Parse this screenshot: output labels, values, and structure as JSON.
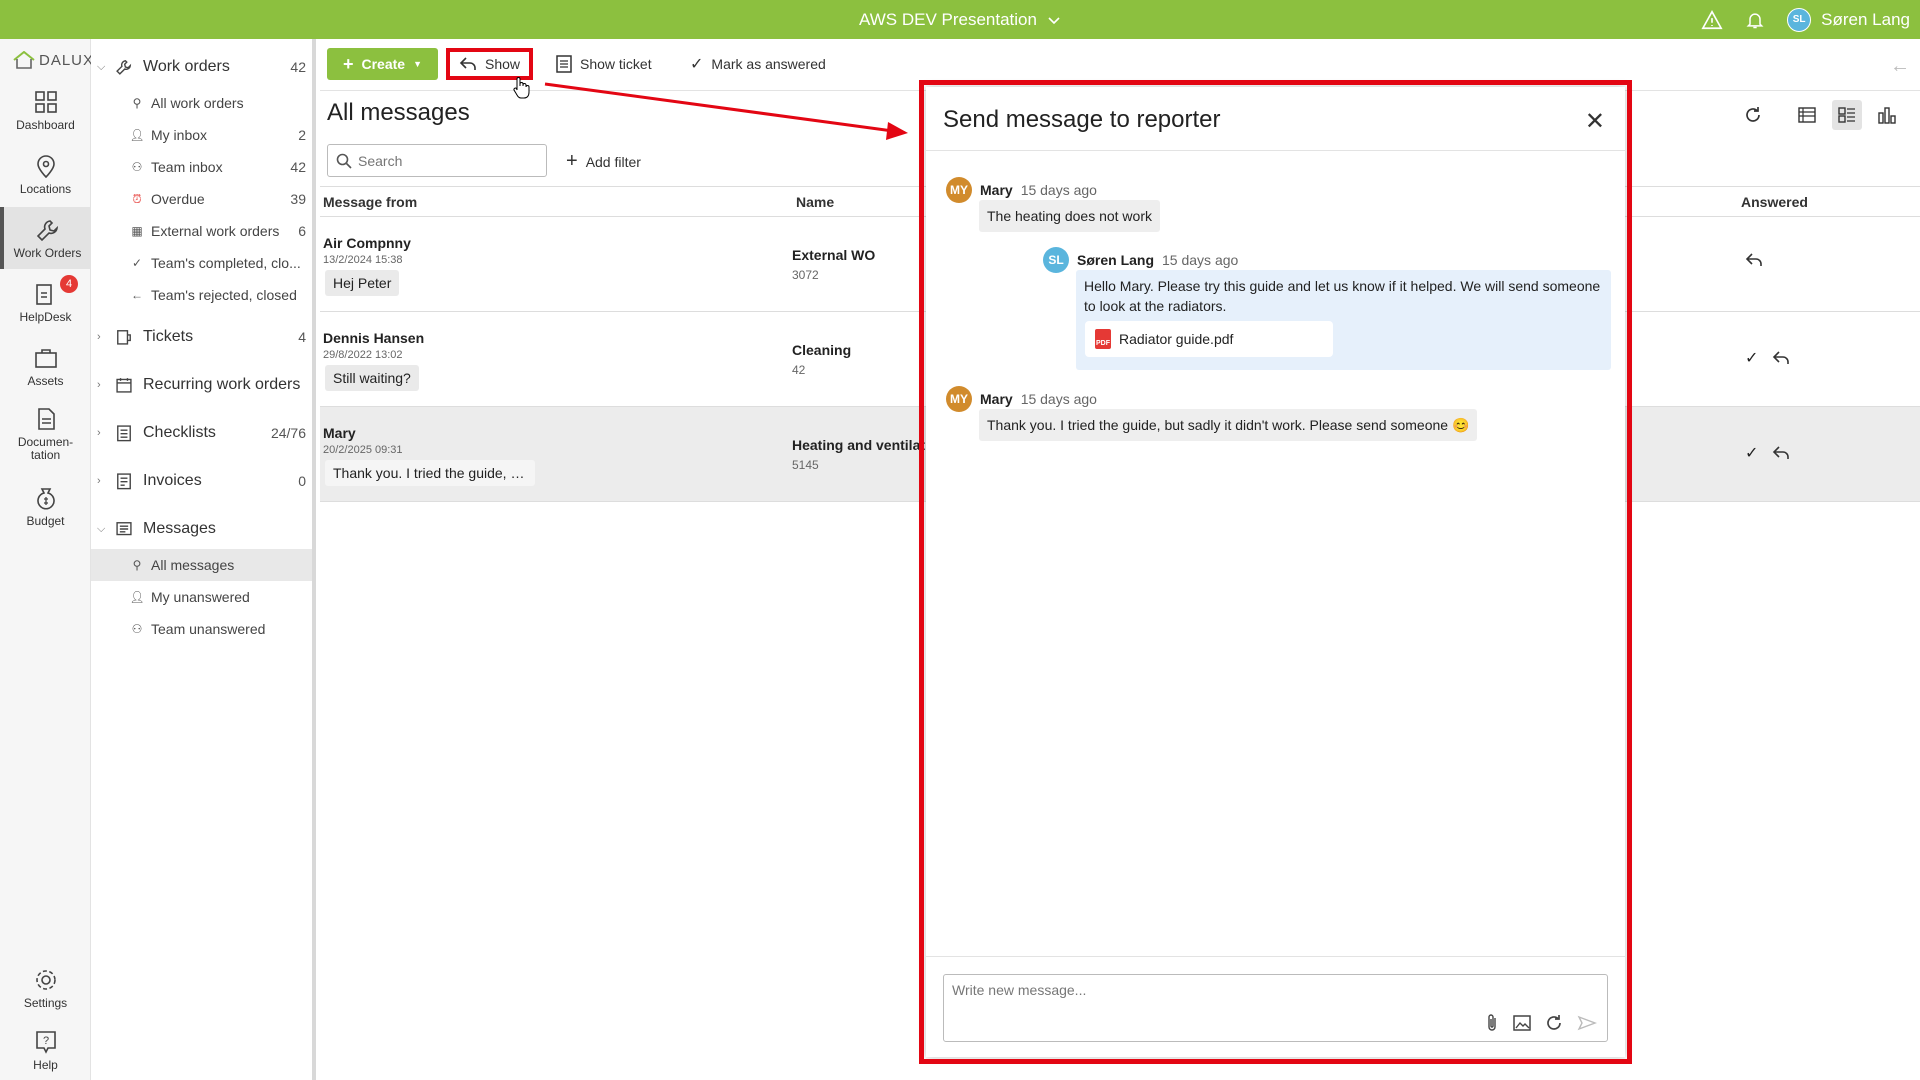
{
  "topbar": {
    "project": "AWS DEV Presentation",
    "user_name": "Søren Lang",
    "user_initials": "SL"
  },
  "logo": "DALUX",
  "rail": [
    {
      "label": "Dashboard",
      "icon": "dashboard-icon"
    },
    {
      "label": "Locations",
      "icon": "location-pin-icon"
    },
    {
      "label": "Work Orders",
      "icon": "wrench-icon",
      "active": true
    },
    {
      "label": "HelpDesk",
      "icon": "helpdesk-icon",
      "badge": "4"
    },
    {
      "label": "Assets",
      "icon": "assets-icon"
    },
    {
      "label": "Documen-\ntation",
      "icon": "document-icon"
    },
    {
      "label": "Budget",
      "icon": "money-bag-icon"
    },
    {
      "label": "Settings",
      "icon": "gear-icon"
    },
    {
      "label": "Help",
      "icon": "help-icon"
    }
  ],
  "nav": {
    "work_orders": {
      "label": "Work orders",
      "count": "42"
    },
    "work_orders_subs": [
      {
        "label": "All work orders",
        "count": ""
      },
      {
        "label": "My inbox",
        "count": "2"
      },
      {
        "label": "Team inbox",
        "count": "42"
      },
      {
        "label": "Overdue",
        "count": "39"
      },
      {
        "label": "External work orders",
        "count": "6"
      },
      {
        "label": "Team's completed, clo...",
        "count": ""
      },
      {
        "label": "Team's rejected, closed",
        "count": ""
      }
    ],
    "tickets": {
      "label": "Tickets",
      "count": "4"
    },
    "recurring": {
      "label": "Recurring work orders",
      "count": ""
    },
    "checklists": {
      "label": "Checklists",
      "count": "24/76"
    },
    "invoices": {
      "label": "Invoices",
      "count": "0"
    },
    "messages": {
      "label": "Messages",
      "count": ""
    },
    "messages_subs": [
      {
        "label": "All messages"
      },
      {
        "label": "My unanswered"
      },
      {
        "label": "Team unanswered"
      }
    ]
  },
  "toolbar": {
    "create": "Create",
    "show": "Show",
    "show_ticket": "Show ticket",
    "mark_answered": "Mark as answered"
  },
  "main": {
    "title": "All messages",
    "search_placeholder": "Search",
    "add_filter": "Add filter",
    "columns": {
      "from": "Message from",
      "name": "Name",
      "answered": "Answered"
    },
    "rows": [
      {
        "from": "Air Compnny",
        "date": "13/2/2024 15:38",
        "preview": "Hej Peter",
        "name": "External WO",
        "num": "3072"
      },
      {
        "from": "Dennis Hansen",
        "date": "29/8/2022 13:02",
        "preview": "Still waiting?",
        "name": "Cleaning",
        "num": "42"
      },
      {
        "from": "Mary",
        "date": "20/2/2025 09:31",
        "preview": "Thank you. I tried the guide, bu...",
        "name": "Heating and ventilat",
        "num": "5145"
      }
    ]
  },
  "modal": {
    "title": "Send message to reporter",
    "messages": [
      {
        "author": "Mary",
        "initials": "MY",
        "ago": "15 days ago",
        "text": "The heating does not work"
      },
      {
        "author": "Søren Lang",
        "initials": "SL",
        "ago": "15 days ago",
        "text": "Hello Mary. Please try this guide and let us know if it helped. We will send someone to look at the radiators.",
        "attachment": "Radiator guide.pdf"
      },
      {
        "author": "Mary",
        "initials": "MY",
        "ago": "15 days ago",
        "text": "Thank you. I tried the guide, but sadly it didn't work. Please send someone 😊"
      }
    ],
    "compose_placeholder": "Write new message..."
  },
  "colors": {
    "brand": "#8cc03f",
    "annotation": "#e30613",
    "badge": "#e53935"
  }
}
